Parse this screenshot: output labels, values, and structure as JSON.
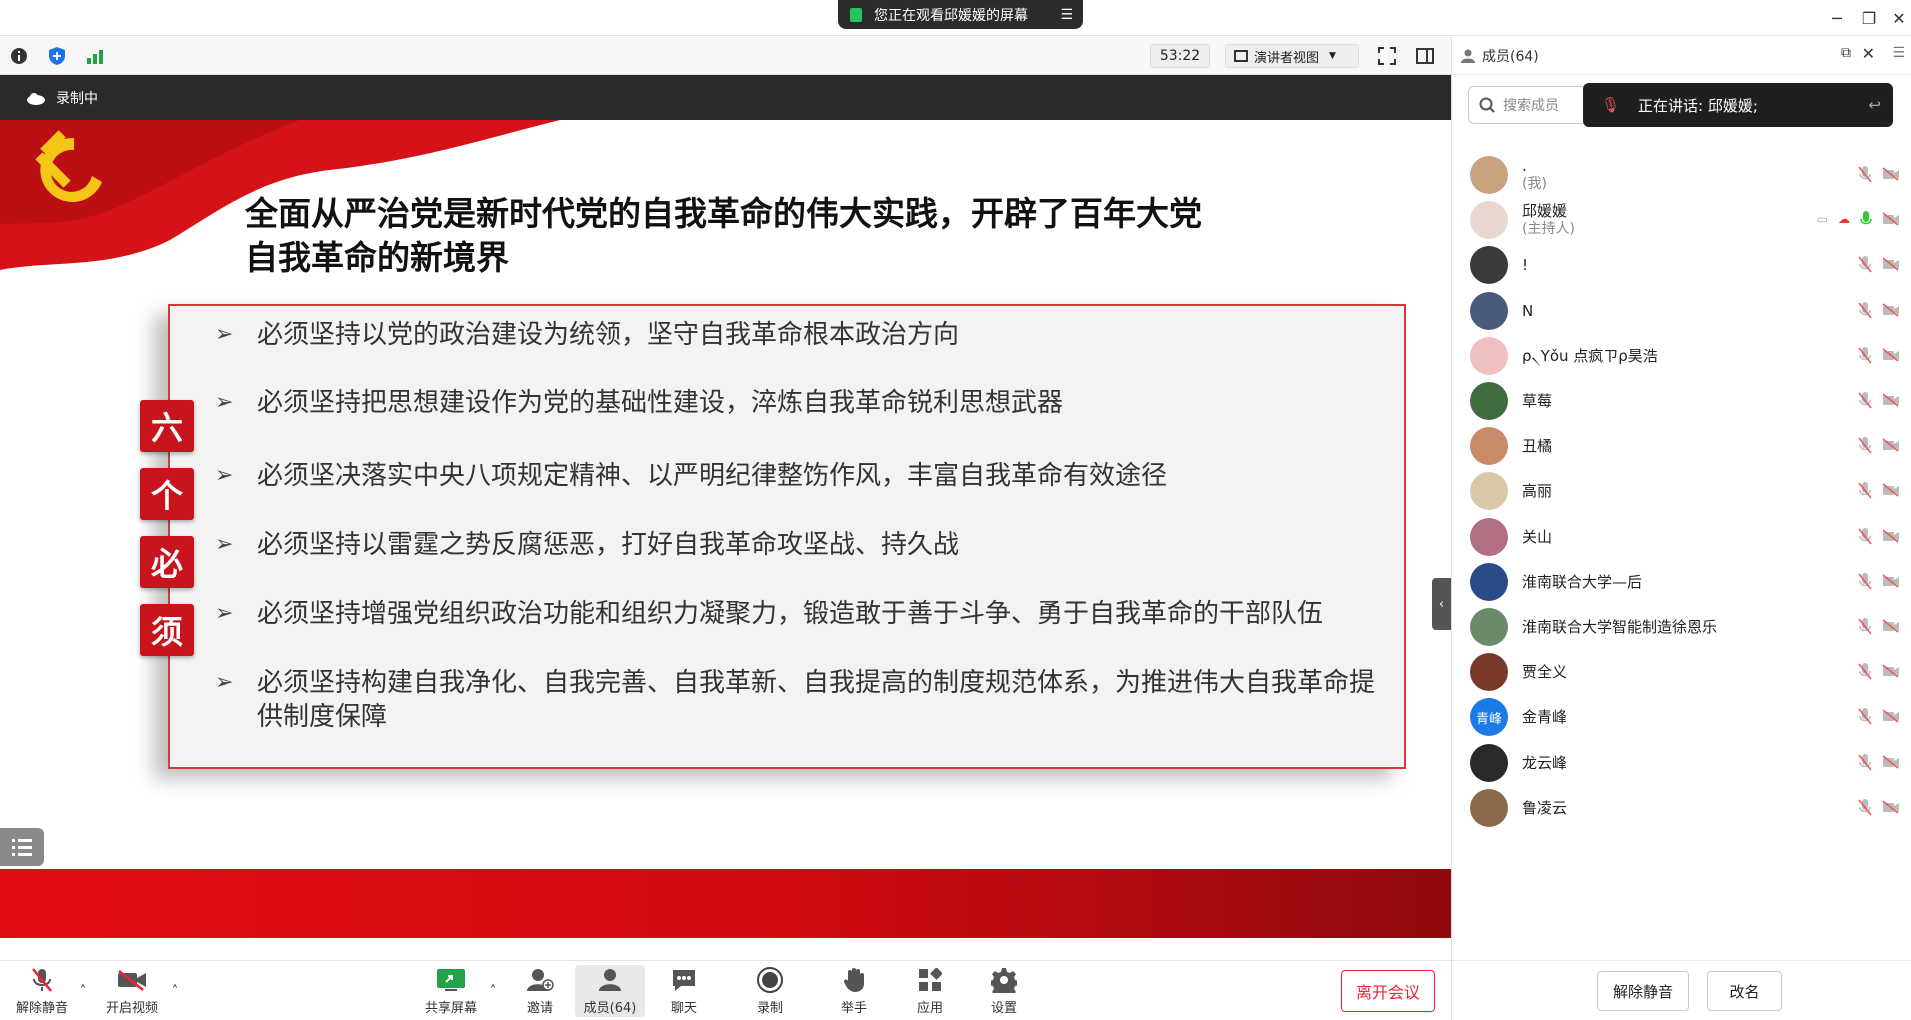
{
  "titlebar": {
    "share_notice": "您正在观看邱媛媛的屏幕",
    "window_controls": [
      "minimize-icon",
      "restore-icon",
      "close-icon"
    ]
  },
  "toolbar": {
    "timer": "53:22",
    "view_mode": "演讲者视图"
  },
  "recording": {
    "label": "录制中"
  },
  "slide": {
    "title_line1": "全面从严治党是新时代党的自我革命的伟大实践，开辟了百年大党",
    "title_line2": "自我革命的新境界",
    "badges": [
      "六",
      "个",
      "必",
      "须"
    ],
    "bullets": [
      "必须坚持以党的政治建设为统领，坚守自我革命根本政治方向",
      "必须坚持把思想建设作为党的基础性建设，淬炼自我革命锐利思想武器",
      "必须坚决落实中央八项规定精神、以严明纪律整饬作风，丰富自我革命有效途径",
      "必须坚持以雷霆之势反腐惩恶，打好自我革命攻坚战、持久战",
      "必须坚持增强党组织政治功能和组织力凝聚力，锻造敢于善于斗争、勇于自我革命的干部队伍",
      "必须坚持构建自我净化、自我完善、自我革新、自我提高的制度规范体系，为推进伟大自我革命提供制度保障"
    ],
    "colors": {
      "accent_red": "#c8141c",
      "frame_red": "#d43a3a"
    }
  },
  "bottombar": {
    "unmute": "解除静音",
    "start_video": "开启视频",
    "share_screen": "共享屏幕",
    "invite": "邀请",
    "members": "成员(64)",
    "chat": "聊天",
    "record": "录制",
    "raise_hand": "举手",
    "apps": "应用",
    "settings": "设置",
    "leave": "离开会议"
  },
  "panel": {
    "title": "成员(64)",
    "search_placeholder": "搜索成员",
    "speaking": "正在讲话: 邱媛媛;",
    "members": [
      {
        "name": ".",
        "role": "(我)"
      },
      {
        "name": "邱媛媛",
        "role": "(主持人)"
      },
      {
        "name": "!",
        "role": ""
      },
      {
        "name": "N",
        "role": ""
      },
      {
        "name": "ρ৲Yǒu 点疯ㄗρ昊浩",
        "role": ""
      },
      {
        "name": "草莓",
        "role": ""
      },
      {
        "name": "丑橘",
        "role": ""
      },
      {
        "name": "高丽",
        "role": ""
      },
      {
        "name": "关山",
        "role": ""
      },
      {
        "name": "淮南联合大学—后",
        "role": ""
      },
      {
        "name": "淮南联合大学智能制造徐恩乐",
        "role": ""
      },
      {
        "name": "贾全义",
        "role": ""
      },
      {
        "name": "金青峰",
        "role": "",
        "avatar_text": "青峰"
      },
      {
        "name": "龙云峰",
        "role": ""
      },
      {
        "name": "鲁凌云",
        "role": ""
      }
    ],
    "unmute_all": "解除静音",
    "rename": "改名"
  }
}
